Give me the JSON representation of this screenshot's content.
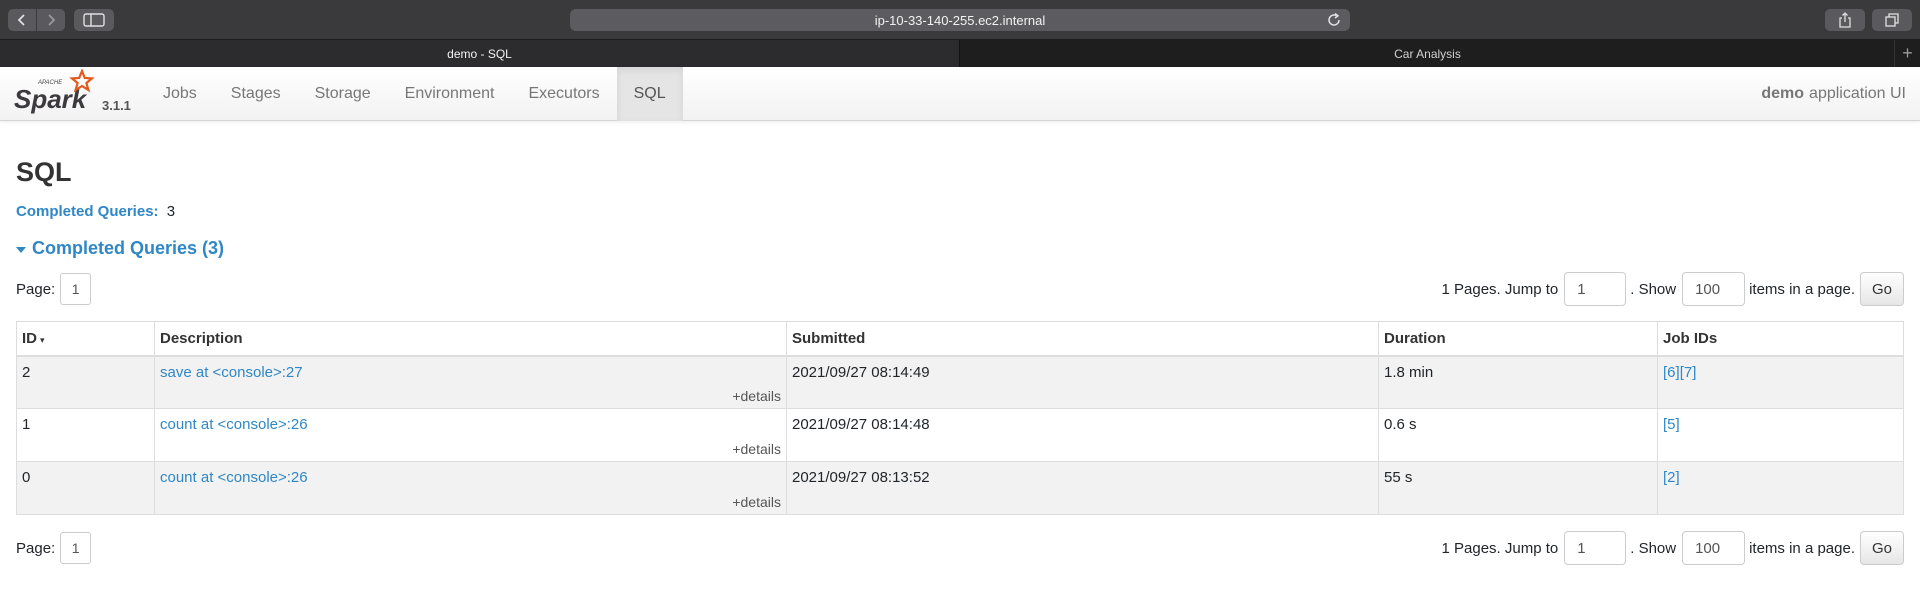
{
  "browser": {
    "url": "ip-10-33-140-255.ec2.internal",
    "tabs": [
      {
        "label": "demo - SQL",
        "active": true
      },
      {
        "label": "Car Analysis",
        "active": false
      }
    ],
    "newtab_label": "+"
  },
  "navbar": {
    "version": "3.1.1",
    "links": [
      {
        "label": "Jobs",
        "active": false
      },
      {
        "label": "Stages",
        "active": false
      },
      {
        "label": "Storage",
        "active": false
      },
      {
        "label": "Environment",
        "active": false
      },
      {
        "label": "Executors",
        "active": false
      },
      {
        "label": "SQL",
        "active": true
      }
    ],
    "app_name": "demo",
    "app_suffix": "application UI"
  },
  "page": {
    "title": "SQL",
    "summary_label": "Completed Queries:",
    "summary_value": "3",
    "section_title": "Completed Queries (3)"
  },
  "pager": {
    "page_label": "Page:",
    "current_page": "1",
    "pages_text": "1 Pages. Jump to",
    "jump_value": "1",
    "show_text": ". Show",
    "show_value": "100",
    "items_text": "items in a page.",
    "go_label": "Go"
  },
  "table": {
    "headers": {
      "id": "ID",
      "sort_mark": "▾",
      "description": "Description",
      "submitted": "Submitted",
      "duration": "Duration",
      "job_ids": "Job IDs"
    },
    "details_label": "+details",
    "rows": [
      {
        "id": "2",
        "description": "save at <console>:27",
        "submitted": "2021/09/27 08:14:49",
        "duration": "1.8 min",
        "job_ids": [
          "[6]",
          "[7]"
        ]
      },
      {
        "id": "1",
        "description": "count at <console>:26",
        "submitted": "2021/09/27 08:14:48",
        "duration": "0.6 s",
        "job_ids": [
          "[5]"
        ]
      },
      {
        "id": "0",
        "description": "count at <console>:26",
        "submitted": "2021/09/27 08:13:52",
        "duration": "55 s",
        "job_ids": [
          "[2]"
        ]
      }
    ]
  },
  "colors": {
    "link": "#2f87c6",
    "chrome": "#3a3a3c",
    "spark_orange": "#e25a1c"
  },
  "icons": [
    "back-icon",
    "forward-icon",
    "sidebar-icon",
    "reload-icon",
    "share-icon",
    "tabs-overview-icon",
    "spark-logo"
  ]
}
